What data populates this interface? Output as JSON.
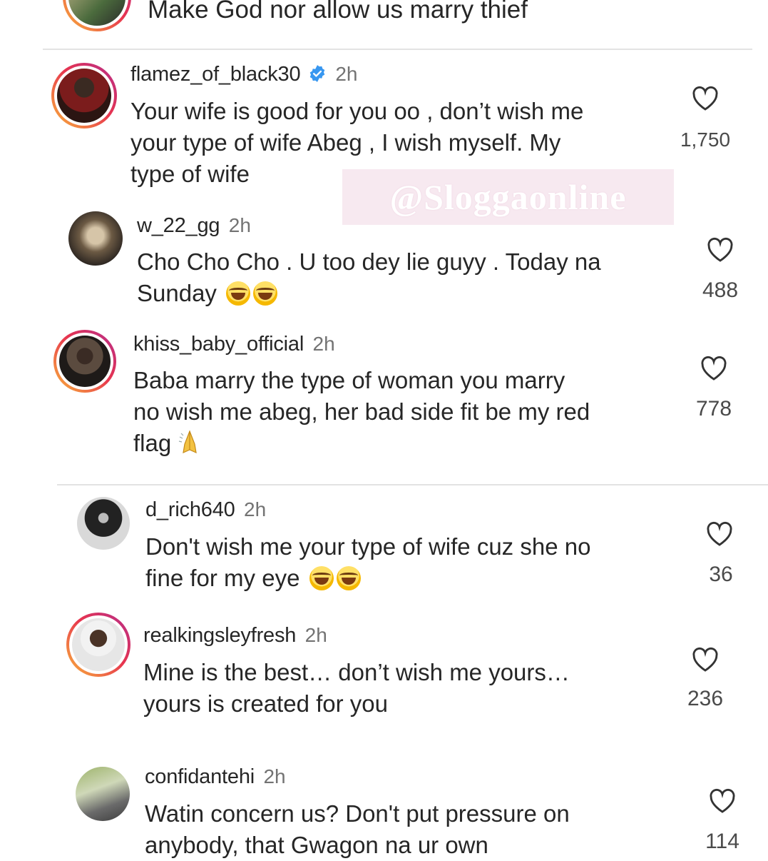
{
  "top_comment": {
    "text": "Make God nor allow us marry thief"
  },
  "watermark": "@Sloggaonline",
  "comments": [
    {
      "username": "flamez_of_black30",
      "verified": true,
      "time": "2h",
      "lines": [
        "Your wife is good for you oo , don’t wish me",
        "your type of wife Abeg , I wish myself. My",
        "type of wife"
      ],
      "likes": "1,750"
    },
    {
      "username": "w_22_gg",
      "time": "2h",
      "lines": [
        "Cho Cho Cho . U too dey lie guyy . Today na",
        "Sunday"
      ],
      "emoji_after_last_line": [
        "face-with-tears-of-joy-icon",
        "face-with-tears-of-joy-icon"
      ],
      "likes": "488"
    },
    {
      "username": "khiss_baby_official",
      "time": "2h",
      "lines": [
        "Baba marry the type of woman you marry",
        "no wish me abeg, her bad side fit be my red",
        "flag"
      ],
      "emoji_after_last_line": [
        "folded-hands-icon"
      ],
      "likes": "778"
    },
    {
      "username": "d_rich640",
      "time": "2h",
      "lines": [
        "Don't wish me your type of wife cuz she no",
        "fine for my eye"
      ],
      "emoji_after_last_line": [
        "face-with-tears-of-joy-icon",
        "face-with-tears-of-joy-icon"
      ],
      "likes": "36"
    },
    {
      "username": "realkingsleyfresh",
      "time": "2h",
      "lines": [
        "Mine is the best… don’t wish me yours…",
        "yours is created for you"
      ],
      "likes": "236"
    },
    {
      "username": "confidantehi",
      "time": "2h",
      "lines": [
        "Watin concern us? Don't  put pressure on",
        "anybody,  that Gwagon na ur own"
      ],
      "likes": "114"
    }
  ],
  "colors": {
    "text": "#262626",
    "meta": "#737373",
    "verified": "#3897f0",
    "ring_start": "#f9b53a",
    "ring_end": "#b52d8c"
  }
}
